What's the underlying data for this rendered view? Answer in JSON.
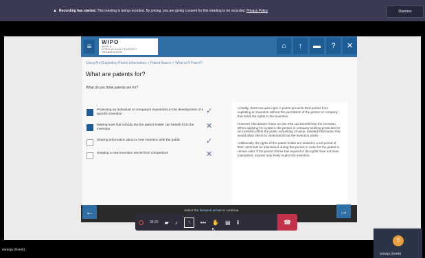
{
  "banner": {
    "bold_text": "Recording has started.",
    "message": " This meeting is being recorded. By joining, you are giving consent for this meeting to be recorded. ",
    "link": "Privacy Policy",
    "dismiss_label": "Dismiss"
  },
  "logo": {
    "name": "WIPO",
    "line1": "WORLD",
    "line2": "INTELLECTUAL PROPERTY",
    "line3": "ORGANIZATION"
  },
  "nav_icons": [
    "home-icon",
    "arrow-up-icon",
    "folder-icon",
    "help-icon",
    "close-icon"
  ],
  "breadcrumb": "Using And Exploiting Patent Information > Patent Basics > What Is A Patent?",
  "title": "What are patents for?",
  "question": "What do you think patents are for?",
  "options": [
    {
      "text": "Protecting an individual or company's investment in the development of a specific invention",
      "checked": true,
      "mark": "✓"
    },
    {
      "text": "Making sure that nobody but the patent holder can benefit from the invention",
      "checked": true,
      "mark": "✕"
    },
    {
      "text": "Sharing information about a new invention with the public",
      "checked": false,
      "mark": "✓"
    },
    {
      "text": "Keeping a new invention secret from competitors",
      "checked": false,
      "mark": "✕"
    }
  ],
  "feedback": [
    "Actually, that's not quite right. A patent prevents third parties from exploiting an invention without the permission of the person or company that holds the rights to this invention.",
    "However, this doesn't mean no one else can benefit from the invention. When applying for a patent, the person or company seeking protection for an invention offers the public something of value: detailed information that would allow others to understand how the invention works.",
    "Additionally, the rights of the patent holder are limited to a set period of time, and must be maintained during this period, in order for the patent to remain valid. If the period of time has expired or the rights have not been maintained, anyone may freely exploit the invention."
  ],
  "forward_hint": {
    "prefix": "Select the ",
    "bold": "forward arrow",
    "suffix": " to continue"
  },
  "toolbar": {
    "timer": "36:20",
    "icons": [
      "camera-icon",
      "microphone-icon",
      "share-screen-icon",
      "more-icon",
      "raise-hand-icon",
      "chat-icon",
      "participants-icon",
      "hang-up-icon"
    ]
  },
  "participant_left": "saraoja (Guest)",
  "participant_tile": {
    "initial": "S",
    "name": "saraoja (Guest)"
  },
  "colors": {
    "brand_blue": "#2f6fa6",
    "hangup_red": "#c4314b",
    "avatar_orange": "#e8a03c"
  }
}
